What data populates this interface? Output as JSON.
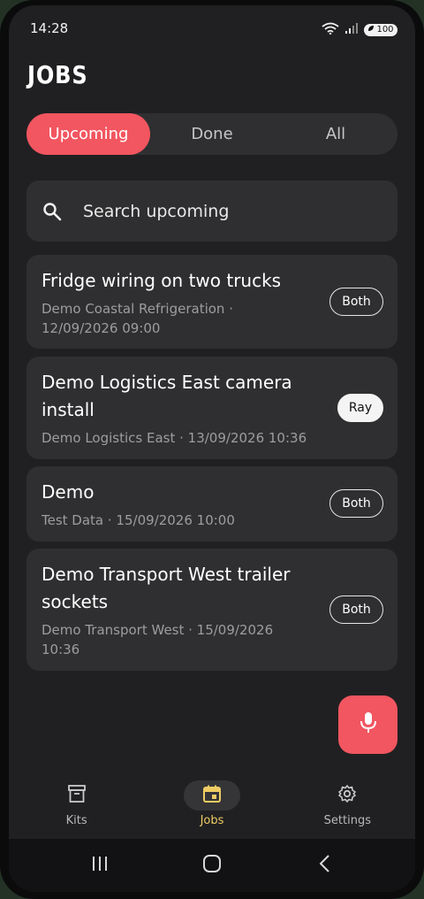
{
  "status_bar": {
    "time": "14:28",
    "battery": "100"
  },
  "page": {
    "title": "JOBS"
  },
  "tabs": [
    {
      "label": "Upcoming",
      "active": true
    },
    {
      "label": "Done",
      "active": false
    },
    {
      "label": "All",
      "active": false
    }
  ],
  "search": {
    "placeholder": "Search upcoming"
  },
  "jobs": [
    {
      "title_lines": [
        "Fridge wiring on two trucks"
      ],
      "sub_lines": [
        "Demo Coastal Refrigeration ·",
        "12/09/2026 09:00"
      ],
      "badge": "Both"
    },
    {
      "title_lines": [
        "Demo Logistics East camera",
        "install"
      ],
      "sub_lines": [
        "Demo Logistics East · 13/09/2026 10:36"
      ],
      "badge": "Ray"
    },
    {
      "title_lines": [
        "Demo"
      ],
      "sub_lines": [
        "Test Data · 15/09/2026 10:00"
      ],
      "badge": "Both"
    },
    {
      "title_lines": [
        "Demo Transport West trailer",
        "sockets"
      ],
      "sub_lines": [
        "Demo Transport West · 15/09/2026",
        "10:36"
      ],
      "badge": "Both"
    }
  ],
  "bottom_nav": [
    {
      "label": "Kits",
      "icon": "archive-icon",
      "active": false
    },
    {
      "label": "Jobs",
      "icon": "calendar-icon",
      "active": true
    },
    {
      "label": "Settings",
      "icon": "gear-icon",
      "active": false
    }
  ],
  "colors": {
    "accent": "#f25660",
    "active_nav": "#efcc63",
    "card": "#2f2f31",
    "background": "#202022"
  }
}
